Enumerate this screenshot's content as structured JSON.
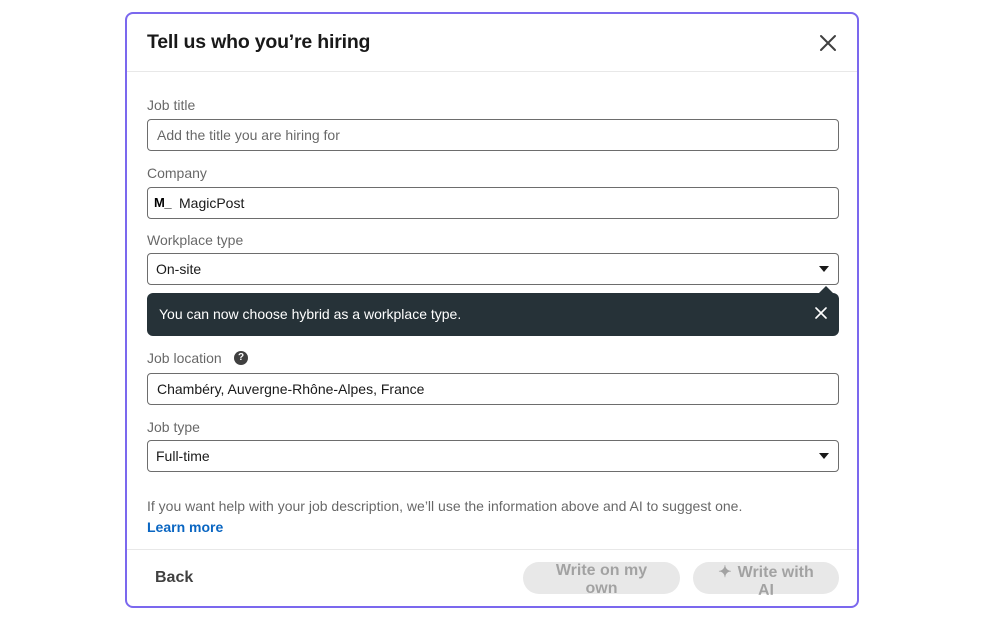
{
  "modal": {
    "title": "Tell us who you’re hiring"
  },
  "fields": {
    "job_title": {
      "label": "Job title",
      "value": "",
      "placeholder": "Add the title you are hiring for"
    },
    "company": {
      "label": "Company",
      "logo_text": "M_",
      "value": "MagicPost"
    },
    "workplace_type": {
      "label": "Workplace type",
      "value": "On-site"
    },
    "job_location": {
      "label": "Job location",
      "value": "Chambéry, Auvergne-Rhône-Alpes, France"
    },
    "job_type": {
      "label": "Job type",
      "value": "Full-time"
    }
  },
  "tooltip": {
    "text": "You can now choose hybrid as a workplace type."
  },
  "help": {
    "text": "If you want help with your job description, we’ll use the information above and AI to suggest one.",
    "link": "Learn more"
  },
  "footer": {
    "back_label": "Back",
    "write_own_label": "Write on my own",
    "write_ai_label": "Write with AI"
  },
  "icons": {
    "close": "close-icon",
    "caret": "caret-down-icon",
    "help": "help-icon",
    "sparkle": "sparkle-icon"
  },
  "colors": {
    "modal_border": "#7b68ee",
    "tooltip_bg": "#263238",
    "link": "#0a66c2",
    "disabled_btn_bg": "#e8e8e8"
  }
}
